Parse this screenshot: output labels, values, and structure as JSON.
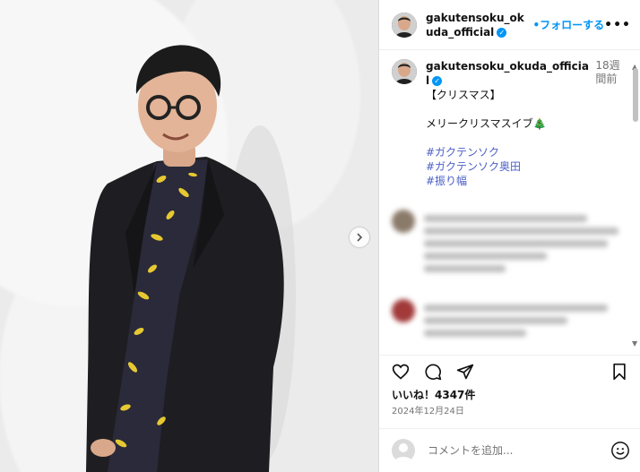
{
  "header": {
    "username": "gakutensoku_okuda_official",
    "follow_label": "フォローする",
    "separator": "•",
    "more_label": "•••"
  },
  "caption": {
    "username": "gakutensoku_okuda_official",
    "time": "18週間前",
    "title": "【クリスマス】",
    "message": "メリークリスマスイブ🎄",
    "hashtags": [
      "#ガクテンソク",
      "#ガクテンソク奥田",
      "#振り幅"
    ]
  },
  "likes": "いいね！4347件",
  "date": "2024年12月24日",
  "comment_box": {
    "placeholder": "コメントを追加..."
  },
  "icons": {
    "like": "heart-icon",
    "comment": "comment-bubble-icon",
    "share": "paper-plane-icon",
    "save": "bookmark-icon",
    "next": "chevron-right-icon",
    "emoji": "smiley-icon",
    "verified": "verified-badge-icon"
  },
  "colors": {
    "accent": "#0095f6",
    "hashtag": "#4a5ec7",
    "secondary_text": "#737373"
  }
}
